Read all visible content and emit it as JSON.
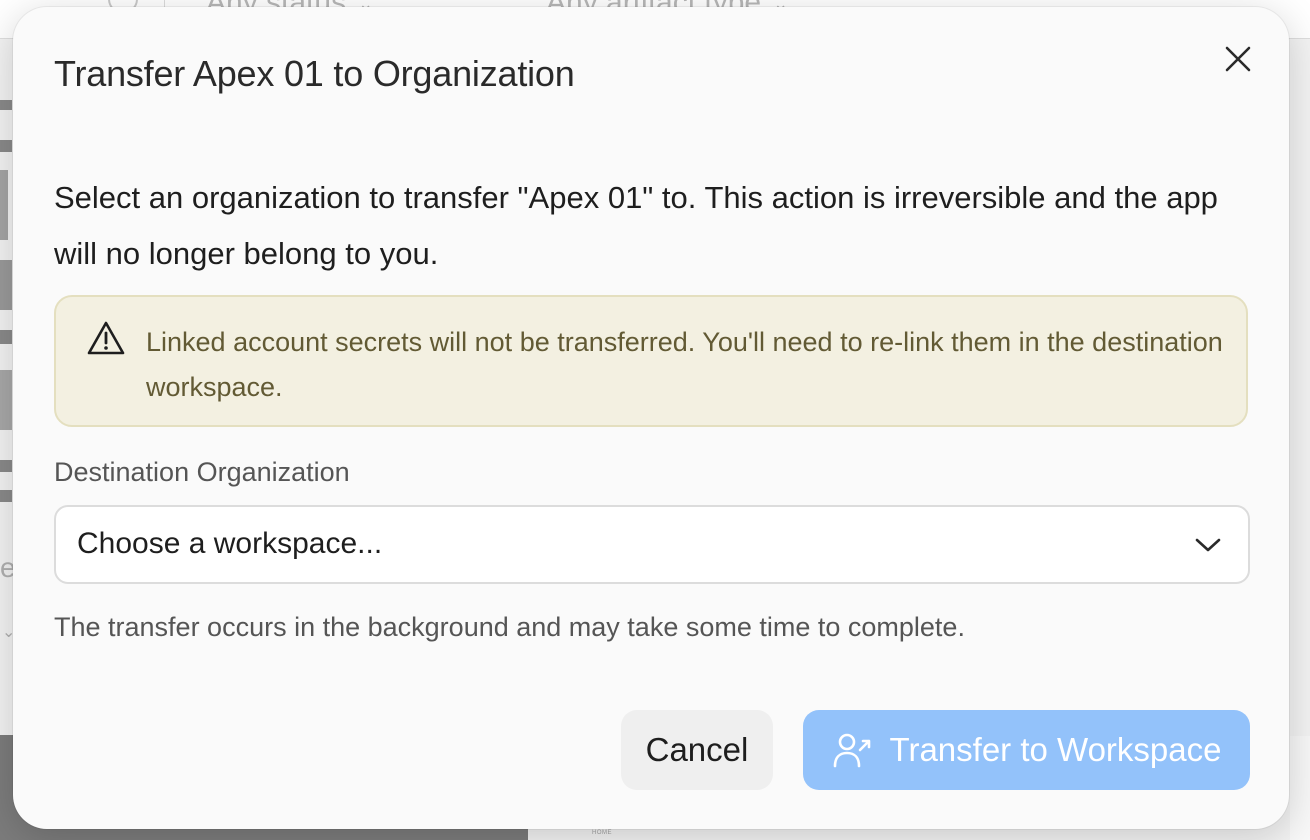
{
  "background": {
    "filter_status": "Any status",
    "filter_type": "Any artifact type",
    "home_label": "HOME"
  },
  "dialog": {
    "title": "Transfer Apex 01 to Organization",
    "close_icon": "close-icon",
    "description": "Select an organization to transfer \"Apex 01\" to. This action is irreversible and the app will no longer belong to you.",
    "warning": {
      "icon": "warning-triangle-icon",
      "text": "Linked account secrets will not be transferred. You'll need to re-link them in the destination workspace."
    },
    "destination": {
      "label": "Destination Organization",
      "placeholder": "Choose a workspace...",
      "chevron_icon": "chevron-down-icon"
    },
    "helper_text": "The transfer occurs in the background and may take some time to complete.",
    "buttons": {
      "cancel": "Cancel",
      "transfer": "Transfer to Workspace",
      "transfer_icon": "user-transfer-icon"
    }
  },
  "colors": {
    "dialog_bg": "#fafafa",
    "warning_bg": "#f3f0e1",
    "warning_border": "#e4dfbf",
    "warning_text": "#625a34",
    "primary_disabled": "#93c2fa",
    "cancel_bg": "#efefef"
  }
}
